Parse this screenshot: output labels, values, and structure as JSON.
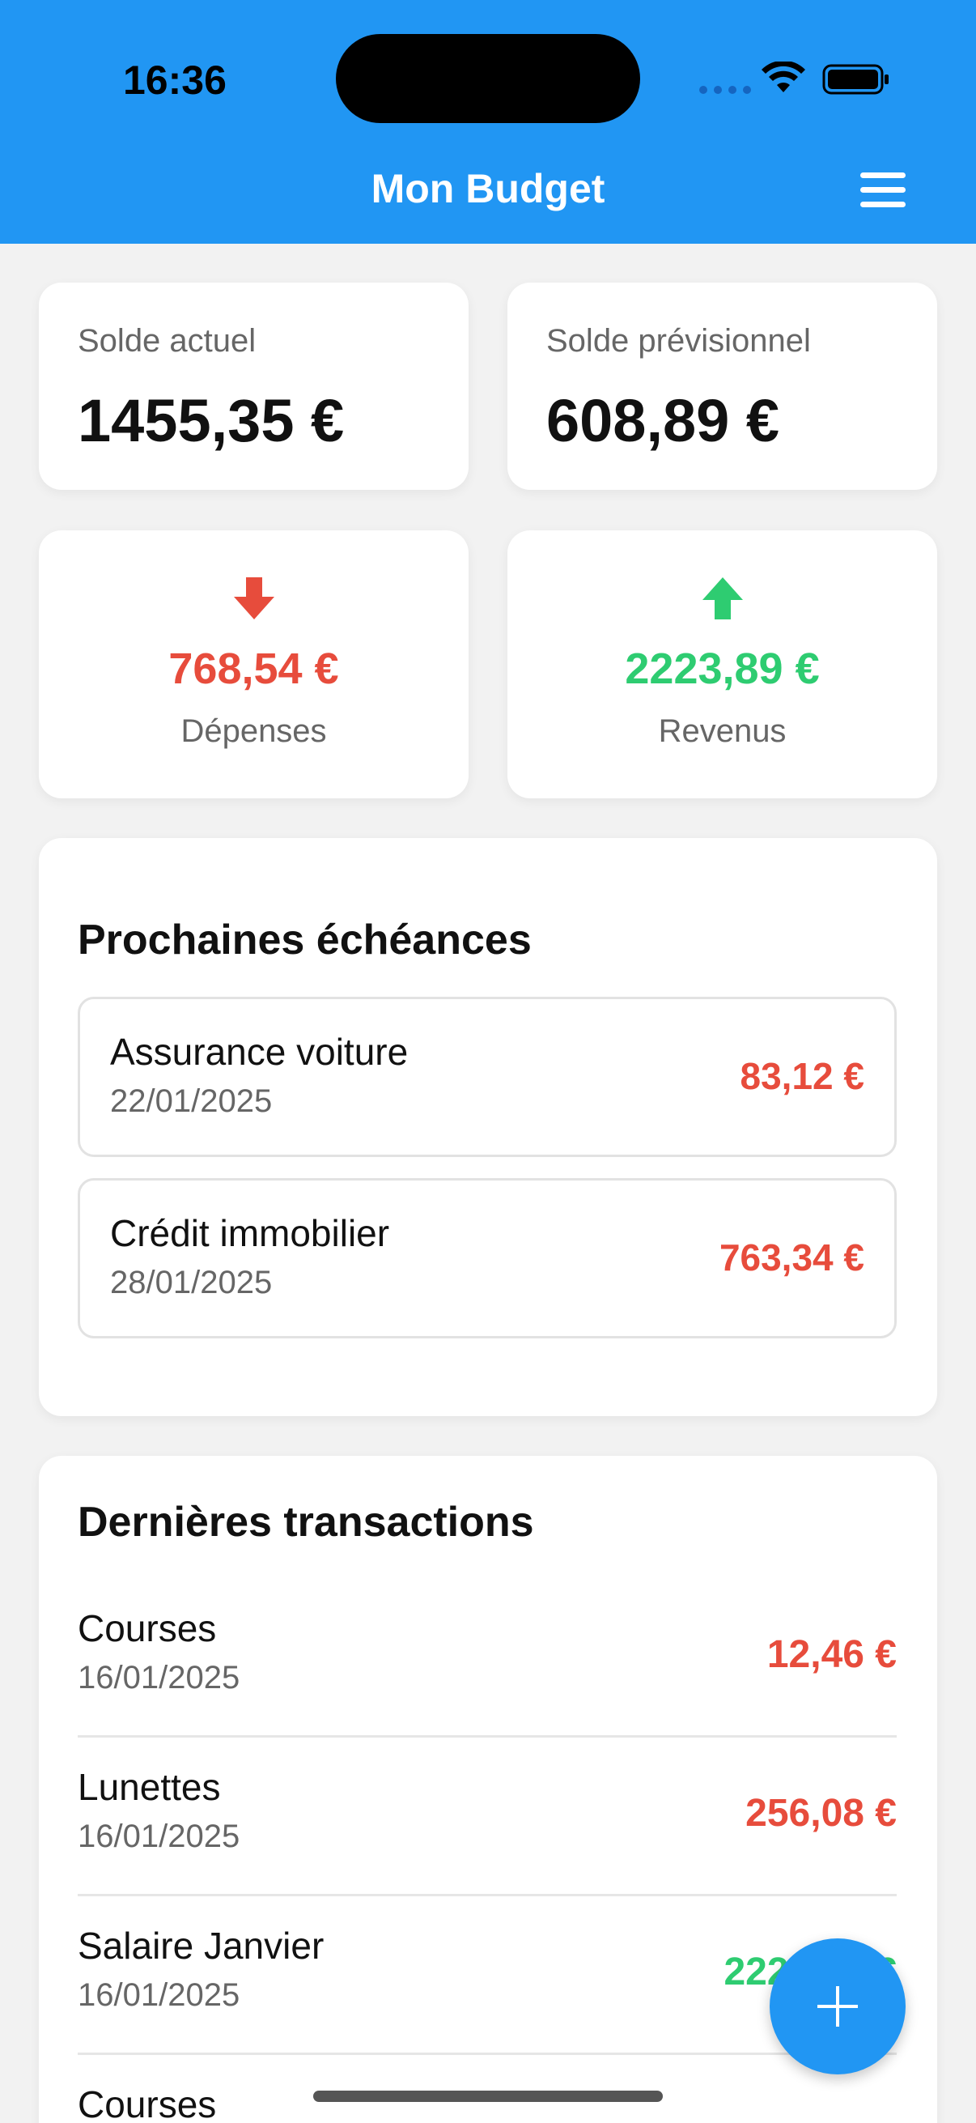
{
  "status_bar": {
    "time": "16:36"
  },
  "header": {
    "title": "Mon Budget"
  },
  "balances": {
    "current": {
      "label": "Solde actuel",
      "value": "1455,35 €"
    },
    "forecast": {
      "label": "Solde prévisionnel",
      "value": "608,89 €"
    }
  },
  "stats": {
    "expenses": {
      "value": "768,54 €",
      "label": "Dépenses",
      "color": "#e74c3c",
      "icon": "arrow-down-icon"
    },
    "income": {
      "value": "2223,89 €",
      "label": "Revenus",
      "color": "#2ecc71",
      "icon": "arrow-up-icon"
    }
  },
  "upcoming": {
    "title": "Prochaines échéances",
    "items": [
      {
        "name": "Assurance voiture",
        "date": "22/01/2025",
        "amount": "83,12 €"
      },
      {
        "name": "Crédit immobilier",
        "date": "28/01/2025",
        "amount": "763,34 €"
      }
    ]
  },
  "transactions": {
    "title": "Dernières transactions",
    "items": [
      {
        "name": "Courses",
        "date": "16/01/2025",
        "amount": "12,46 €",
        "type": "expense"
      },
      {
        "name": "Lunettes",
        "date": "16/01/2025",
        "amount": "256,08 €",
        "type": "expense"
      },
      {
        "name": "Salaire Janvier",
        "date": "16/01/2025",
        "amount": "2223,89 €",
        "type": "income"
      },
      {
        "name": "Courses",
        "date": "",
        "amount": "",
        "type": "expense"
      }
    ]
  },
  "colors": {
    "accent": "#2196f3",
    "expense": "#e74c3c",
    "income": "#2ecc71"
  }
}
